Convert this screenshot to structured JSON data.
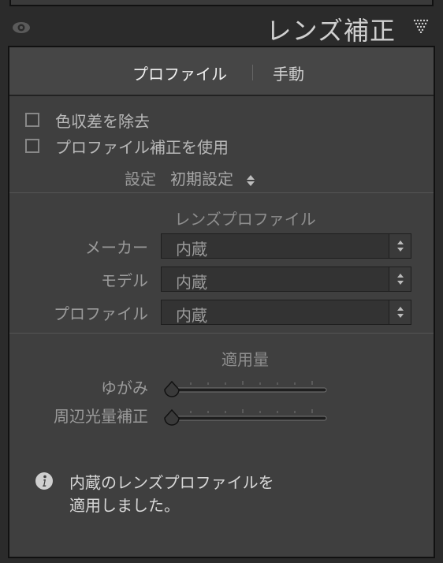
{
  "header": {
    "title": "レンズ補正"
  },
  "tabs": [
    {
      "label": "プロファイル"
    },
    {
      "label": "手動"
    }
  ],
  "checkboxes": [
    {
      "label": "色収差を除去",
      "checked": false
    },
    {
      "label": "プロファイル補正を使用",
      "checked": false
    }
  ],
  "setup": {
    "label": "設定",
    "value": "初期設定"
  },
  "lens_profile": {
    "title": "レンズプロファイル",
    "fields": [
      {
        "label": "メーカー",
        "value": "内蔵"
      },
      {
        "label": "モデル",
        "value": "内蔵"
      },
      {
        "label": "プロファイル",
        "value": "内蔵"
      }
    ]
  },
  "amount": {
    "title": "適用量",
    "sliders": [
      {
        "label": "ゆがみ",
        "value": 0
      },
      {
        "label": "周辺光量補正",
        "value": 0
      }
    ]
  },
  "info": {
    "line1": "内蔵のレンズプロファイルを",
    "line2": "適用しました。"
  }
}
